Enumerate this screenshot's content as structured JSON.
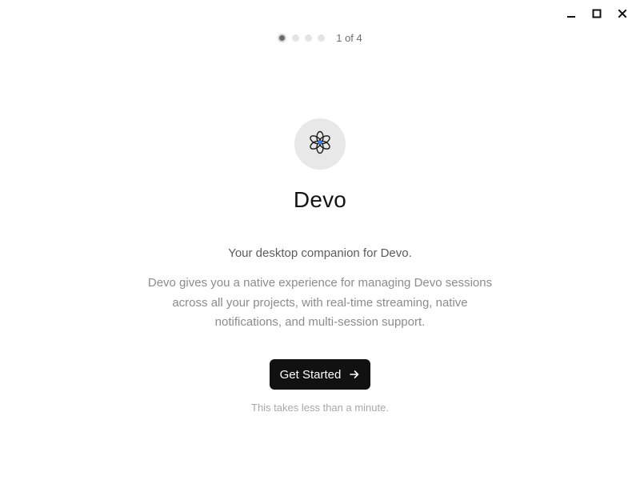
{
  "window": {
    "controls": {
      "minimize_icon": "minimize-icon",
      "maximize_icon": "maximize-icon",
      "close_icon": "close-icon"
    }
  },
  "stepper": {
    "current": 1,
    "total": 4,
    "label": "1 of 4"
  },
  "app": {
    "logo_icon": "flower-logo-icon",
    "name": "Devo",
    "tagline": "Your desktop companion for Devo.",
    "description": "Devo gives you a native experience for managing Devo sessions across all your projects, with real-time streaming, native notifications, and multi-session support."
  },
  "actions": {
    "get_started_label": "Get Started",
    "get_started_icon": "arrow-right-icon",
    "hint": "This takes less than a minute."
  },
  "colors": {
    "background": "#ffffff",
    "button": "#111111",
    "dot_active": "#6b6b6b",
    "dot_inactive": "#e4e4e4",
    "logo_bg": "#e8e8e8",
    "logo_accent": "#3b82f6"
  }
}
